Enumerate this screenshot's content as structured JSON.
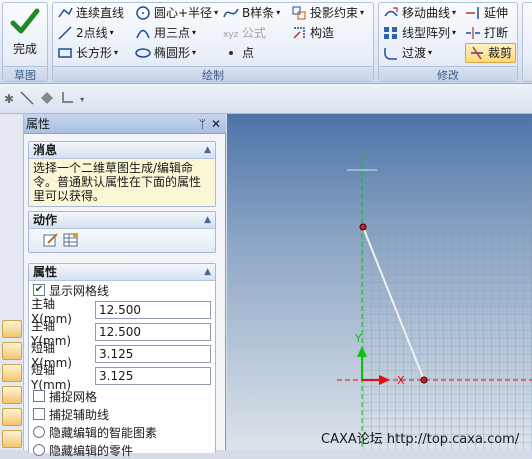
{
  "ribbon": {
    "groups": [
      {
        "caption": "草图"
      },
      {
        "caption": "绘制"
      },
      {
        "caption": "修改"
      }
    ],
    "finish_label": "完成",
    "draw": {
      "col1": [
        "连续直线",
        "2点线",
        "长方形"
      ],
      "col2": [
        "圆心+半径",
        "用三点",
        "椭圆形"
      ],
      "col3": [
        "B样条",
        "公式",
        "点"
      ],
      "col4": [
        "投影约束",
        "构造"
      ]
    },
    "modify": {
      "col1": [
        "移动曲线",
        "线型阵列",
        "过渡"
      ],
      "col2": [
        "延伸",
        "打断",
        "裁剪"
      ]
    }
  },
  "panel": {
    "title": "属性",
    "pin_glyph": "ᛘ",
    "close_glyph": "✕",
    "message": {
      "header": "消息",
      "text": "选择一个二维草图生成/编辑命令。普通默认属性在下面的属性里可以获得。"
    },
    "action": {
      "header": "动作"
    },
    "props": {
      "header": "属性",
      "show_grid": {
        "label": "显示网格线",
        "checked": true
      },
      "fields": [
        {
          "label": "主轴X(mm)",
          "value": "12.500"
        },
        {
          "label": "主轴Y(mm)",
          "value": "12.500"
        },
        {
          "label": "短轴X(mm)",
          "value": "3.125"
        },
        {
          "label": "短轴Y(mm)",
          "value": "3.125"
        }
      ],
      "snap_grid": "捕捉网格",
      "snap_aux": "捕捉辅助线",
      "radio1": "隐藏编辑的智能图素",
      "radio2": "隐藏编辑的零件"
    }
  },
  "canvas": {
    "axis_x": "X",
    "axis_y": "Y",
    "colors": {
      "axis": "#e01010",
      "y_axis": "#10c010",
      "line": "#f0f0f0",
      "grid": "#8aa0b8"
    }
  },
  "watermark": "CAXA论坛 http://top.caxa.com/"
}
